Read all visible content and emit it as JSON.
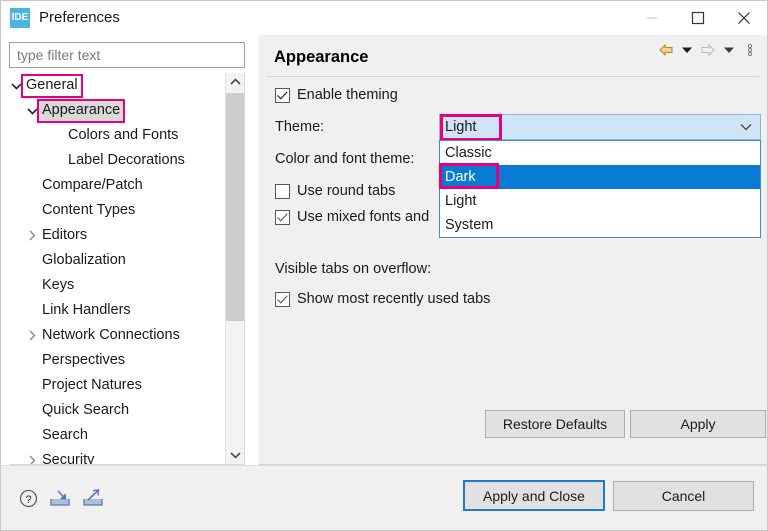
{
  "window": {
    "app_icon_text": "IDE",
    "title": "Preferences",
    "controls": {
      "minimize": "minimize-icon",
      "maximize": "maximize-icon",
      "close": "close-icon"
    }
  },
  "sidebar": {
    "filter": {
      "placeholder": "type filter text",
      "value": ""
    },
    "tree": [
      {
        "label": "General",
        "indent": 0,
        "twisty": "expanded",
        "selected": false,
        "highlighted": true
      },
      {
        "label": "Appearance",
        "indent": 1,
        "twisty": "expanded",
        "selected": true,
        "highlighted": true
      },
      {
        "label": "Colors and Fonts",
        "indent": 2,
        "twisty": "none",
        "selected": false,
        "highlighted": false
      },
      {
        "label": "Label Decorations",
        "indent": 2,
        "twisty": "none",
        "selected": false,
        "highlighted": false
      },
      {
        "label": "Compare/Patch",
        "indent": 1,
        "twisty": "none",
        "selected": false,
        "highlighted": false
      },
      {
        "label": "Content Types",
        "indent": 1,
        "twisty": "none",
        "selected": false,
        "highlighted": false
      },
      {
        "label": "Editors",
        "indent": 1,
        "twisty": "collapsed",
        "selected": false,
        "highlighted": false
      },
      {
        "label": "Globalization",
        "indent": 1,
        "twisty": "none",
        "selected": false,
        "highlighted": false
      },
      {
        "label": "Keys",
        "indent": 1,
        "twisty": "none",
        "selected": false,
        "highlighted": false
      },
      {
        "label": "Link Handlers",
        "indent": 1,
        "twisty": "none",
        "selected": false,
        "highlighted": false
      },
      {
        "label": "Network Connections",
        "indent": 1,
        "twisty": "collapsed",
        "selected": false,
        "highlighted": false
      },
      {
        "label": "Perspectives",
        "indent": 1,
        "twisty": "none",
        "selected": false,
        "highlighted": false
      },
      {
        "label": "Project Natures",
        "indent": 1,
        "twisty": "none",
        "selected": false,
        "highlighted": false
      },
      {
        "label": "Quick Search",
        "indent": 1,
        "twisty": "none",
        "selected": false,
        "highlighted": false
      },
      {
        "label": "Search",
        "indent": 1,
        "twisty": "none",
        "selected": false,
        "highlighted": false
      },
      {
        "label": "Security",
        "indent": 1,
        "twisty": "collapsed",
        "selected": false,
        "highlighted": false
      }
    ],
    "scrollbar": {
      "up_icon": "chevron-up-icon",
      "down_icon": "chevron-down-icon"
    }
  },
  "main": {
    "title": "Appearance",
    "toolbar": {
      "back_icon": "back-arrow-icon",
      "back_menu_icon": "chevron-down-icon",
      "forward_icon": "forward-arrow-icon",
      "forward_menu_icon": "chevron-down-icon",
      "view_menu_icon": "vertical-dots-icon"
    },
    "enable_theming": {
      "label": "Enable theming",
      "checked": true
    },
    "theme": {
      "label": "Theme:",
      "selected": "Light",
      "options": [
        {
          "label": "Classic",
          "selected": false,
          "highlighted": false
        },
        {
          "label": "Dark",
          "selected": true,
          "highlighted": true
        },
        {
          "label": "Light",
          "selected": false,
          "highlighted": false
        },
        {
          "label": "System",
          "selected": false,
          "highlighted": false
        }
      ],
      "open": true
    },
    "color_font_theme": {
      "label": "Color and font theme:"
    },
    "use_round_tabs": {
      "label": "Use round tabs",
      "checked": false
    },
    "use_mixed_fonts": {
      "label": "Use mixed fonts and",
      "checked": true
    },
    "visible_tabs_label": "Visible tabs on overflow:",
    "show_mru_tabs": {
      "label": "Show most recently used tabs",
      "checked": true
    },
    "restore_defaults_label": "Restore Defaults",
    "apply_label": "Apply"
  },
  "footer": {
    "help_icon": "help-icon",
    "import_icon": "import-icon",
    "export_icon": "export-icon",
    "apply_and_close_label": "Apply and Close",
    "cancel_label": "Cancel"
  },
  "colors": {
    "annotation": "#e6007e",
    "selection_blue": "#0a7bd4",
    "combo_fill": "#cfe5f7",
    "accent_icon": "#4ab4e6",
    "focus_border": "#1e7ad4"
  }
}
